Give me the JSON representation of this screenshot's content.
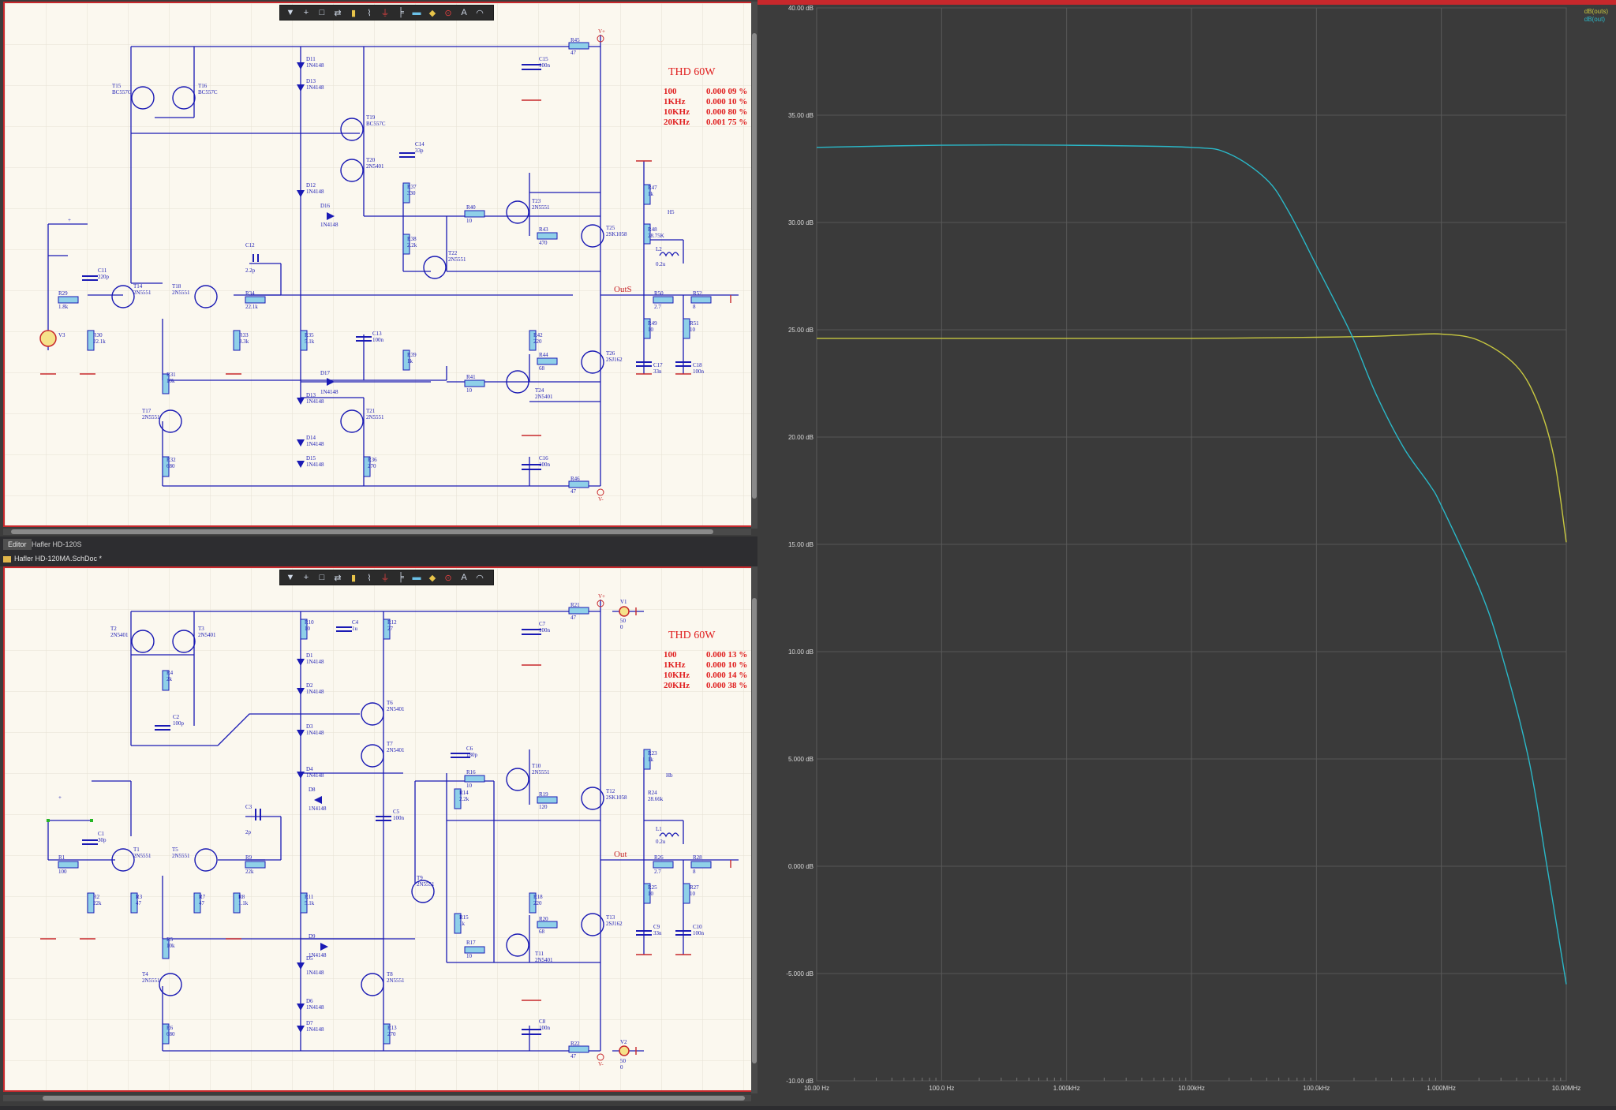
{
  "schematic_top": {
    "toolbar_icons": [
      "filter-icon",
      "plus-icon",
      "select-icon",
      "move-icon",
      "part-icon",
      "wire-icon",
      "ground-icon",
      "bus-icon",
      "port-icon",
      "net-label-icon",
      "power-icon",
      "text-icon",
      "arc-icon"
    ],
    "thd_title": "THD 60W",
    "thd_rows": [
      {
        "freq": "100",
        "value": "0.000 09 %"
      },
      {
        "freq": "1KHz",
        "value": "0.000 10 %"
      },
      {
        "freq": "10KHz",
        "value": "0.000 80 %"
      },
      {
        "freq": "20KHz",
        "value": "0.001 75 %"
      }
    ],
    "net_out": "OutS",
    "labels": {
      "r45": "R45",
      "r45v": "47",
      "c15": "C15",
      "c15v": "100n",
      "d11": "D11",
      "d11v": "1N4148",
      "d13": "D13",
      "d13v": "1N4148",
      "t15": "T15",
      "t15v": "BC557C",
      "t16": "T16",
      "t16v": "BC557C",
      "t19": "T19",
      "t19v": "BC557C",
      "t20": "T20",
      "t20v": "2N5401",
      "c14": "C14",
      "c14v": "33p",
      "d12": "D12",
      "d12v": "1N4148",
      "d16": "D16",
      "d16v": "1N4148",
      "r37": "R37",
      "r37v": "330",
      "r40": "R40",
      "r40v": "10",
      "t23": "T23",
      "t23v": "2N5551",
      "r43": "R43",
      "r43v": "470",
      "t25": "T25",
      "t25v": "2SK1058",
      "r47": "R47",
      "r47v": "1k",
      "r48": "R48",
      "r48v": "28.75K",
      "l2": "L2",
      "l2v": "0.2u",
      "r38": "R38",
      "r38v": "2.2k",
      "t22": "T22",
      "t22v": "2N5551",
      "c12": "C12",
      "c12v": "2.2p",
      "c11": "C11",
      "c11v": "220p",
      "t14": "T14",
      "t14v": "2N5551",
      "t18": "T18",
      "t18v": "2N5551",
      "r29": "R29",
      "r29v": "1.8k",
      "r34": "R34",
      "r34v": "22.1k",
      "r50": "R50",
      "r50v": "2.7",
      "r52": "R52",
      "r52v": "8",
      "v3": "V3",
      "r30": "R30",
      "r30v": "22.1k",
      "r33": "R33",
      "r33v": "3.3k",
      "r35": "R35",
      "r35v": "5.1k",
      "c13": "C13",
      "c13v": "100n",
      "r42": "R42",
      "r42v": "220",
      "r44": "R44",
      "r44v": "68",
      "t26": "T26",
      "t26v": "2SJ162",
      "r49": "R49",
      "r49v": "10",
      "r51": "R51",
      "r51v": "10",
      "c17": "C17",
      "c17v": "33n",
      "c18": "C18",
      "c18v": "100n",
      "r31": "R31",
      "r31v": "10k",
      "d17": "D17",
      "d17v": "1N4148",
      "r39": "R39",
      "r39v": "1k",
      "r41": "R41",
      "r41v": "10",
      "t24": "T24",
      "t24v": "2N5401",
      "t17": "T17",
      "t17v": "2N5551",
      "d13b": "D13",
      "d13bv": "1N4148",
      "t21": "T21",
      "t21v": "2N5551",
      "d14": "D14",
      "d14v": "1N4148",
      "d15": "D15",
      "d15v": "1N4148",
      "r32": "R32",
      "r32v": "680",
      "r36": "R36",
      "r36v": "270",
      "c16": "C16",
      "c16v": "100n",
      "r46": "R46",
      "r46v": "47",
      "vplus": "V+",
      "vminus": "V-",
      "dot": "+",
      "hb": "H5"
    }
  },
  "tabs": {
    "editor": "Editor",
    "project": "Hafler HD-120S",
    "document": "Hafler HD-120MA.SchDoc *"
  },
  "schematic_bottom": {
    "thd_title": "THD 60W",
    "thd_rows": [
      {
        "freq": "100",
        "value": "0.000 13 %"
      },
      {
        "freq": "1KHz",
        "value": "0.000 10 %"
      },
      {
        "freq": "10KHz",
        "value": "0.000 14 %"
      },
      {
        "freq": "20KHz",
        "value": "0.000 38 %"
      }
    ],
    "net_out": "Out",
    "labels": {
      "t2": "T2",
      "t2v": "2N5401",
      "t3": "T3",
      "t3v": "2N5401",
      "r10": "R10",
      "r10v": "10",
      "c4": "C4",
      "c4v": "1u",
      "r12": "R12",
      "r12v": "27",
      "r21": "R21",
      "r21v": "47",
      "v1": "V1",
      "v1v": "50",
      "v1z": "0",
      "c7": "C7",
      "c7v": "100n",
      "d1": "D1",
      "d1v": "1N4148",
      "r4": "R4",
      "r4v": "2k",
      "d2": "D2",
      "d2v": "1N4148",
      "t6": "T6",
      "t6v": "2N5401",
      "c2": "C2",
      "c2v": "100p",
      "d3": "D3",
      "d3v": "1N4148",
      "t7": "T7",
      "t7v": "2N5401",
      "c6": "C6",
      "c6v": "180p",
      "r23": "R23",
      "r23v": "1k",
      "d4": "D4",
      "d4v": "1N4148",
      "r16": "R16",
      "r16v": "10",
      "t10": "T10",
      "t10v": "2N5551",
      "d8": "D8",
      "d8v": "1N4148",
      "r14": "R14",
      "r14v": "2.2k",
      "r19": "R19",
      "r19v": "120",
      "t12": "T12",
      "t12v": "2SK1058",
      "r24": "R24",
      "r24v": "28.66k",
      "c3": "C3",
      "c3v": "2p",
      "c5": "C5",
      "c5v": "100n",
      "l1": "L1",
      "l1v": "0.2u",
      "c1": "C1",
      "c1v": "30p",
      "t1": "T1",
      "t1v": "2N5551",
      "t5": "T5",
      "t5v": "2N5551",
      "r1": "R1",
      "r1v": "100",
      "r9": "R9",
      "r9v": "22k",
      "r26": "R26",
      "r26v": "2.7",
      "r28": "R28",
      "r28v": "8",
      "r2": "R2",
      "r2v": "22k",
      "r3": "R3",
      "r3v": "47",
      "r7": "R7",
      "r7v": "47",
      "r8": "R8",
      "r8v": "1.1k",
      "r11": "R11",
      "r11v": "5.1k",
      "t9": "T9",
      "t9v": "2N5551",
      "r18": "R18",
      "r18v": "220",
      "r15": "R15",
      "r15v": "1k",
      "r20": "R20",
      "r20v": "68",
      "t13": "T13",
      "t13v": "2SJ162",
      "r25": "R25",
      "r25v": "10",
      "r27": "R27",
      "r27v": "10",
      "c9": "C9",
      "c9v": "33n",
      "c10": "C10",
      "c10v": "100n",
      "r5": "R5",
      "r5v": "10k",
      "d9": "D9",
      "d9v": "1N4148",
      "r17": "R17",
      "r17v": "10",
      "t11": "T11",
      "t11v": "2N5401",
      "t4": "T4",
      "t4v": "2N5551",
      "t8": "T8",
      "t8v": "2N5551",
      "d5": "D5",
      "d5v": "1N4148",
      "d6": "D6",
      "d6v": "1N4148",
      "d7": "D7",
      "d7v": "1N4148",
      "r6": "R6",
      "r6v": "680",
      "r13": "R13",
      "r13v": "270",
      "c8": "C8",
      "c8v": "100n",
      "r22": "R22",
      "r22v": "47",
      "v2": "V2",
      "v2v": "50",
      "v2z": "0",
      "vplus": "V+",
      "vminus": "V-",
      "dot": "+",
      "hb": "Hb"
    }
  },
  "plot": {
    "legend": [
      {
        "name": "dB(outs)",
        "color": "#c8c840"
      },
      {
        "name": "dB(out)",
        "color": "#2ab8c8"
      }
    ],
    "y_ticks": [
      "40.00 dB",
      "35.00 dB",
      "30.00 dB",
      "25.00 dB",
      "20.00 dB",
      "15.00 dB",
      "10.00 dB",
      "5.000 dB",
      "0.000 dB",
      "-5.000 dB",
      "-10.00 dB"
    ],
    "x_ticks": [
      "10.00 Hz",
      "100.0 Hz",
      "1.000kHz",
      "10.00kHz",
      "100.0kHz",
      "1.000MHz",
      "10.00MHz"
    ]
  },
  "chart_data": {
    "type": "line",
    "title": "",
    "xlabel": "",
    "ylabel": "",
    "x_scale": "log",
    "xlim": [
      10,
      10000000
    ],
    "ylim": [
      -10,
      40
    ],
    "grid": true,
    "legend_position": "top-right",
    "series": [
      {
        "name": "dB(outs)",
        "color": "#c8c840",
        "x": [
          10,
          100,
          1000,
          10000,
          100000,
          300000,
          500000,
          1000000,
          2000000,
          4000000,
          6000000,
          8000000,
          10000000
        ],
        "values": [
          24.6,
          24.6,
          24.6,
          24.6,
          24.65,
          24.7,
          24.75,
          24.8,
          24.5,
          23.3,
          21.5,
          19.0,
          15.1
        ]
      },
      {
        "name": "dB(out)",
        "color": "#2ab8c8",
        "x": [
          10,
          100,
          1000,
          10000,
          20000,
          40000,
          60000,
          100000,
          150000,
          200000,
          300000,
          500000,
          800000,
          1000000,
          2000000,
          3000000,
          5000000,
          7000000,
          10000000
        ],
        "values": [
          33.5,
          33.6,
          33.6,
          33.5,
          33.2,
          32.0,
          30.5,
          28.0,
          26.0,
          24.5,
          22.0,
          19.5,
          17.8,
          16.8,
          13.0,
          10.0,
          5.0,
          0.0,
          -5.5
        ]
      }
    ]
  }
}
